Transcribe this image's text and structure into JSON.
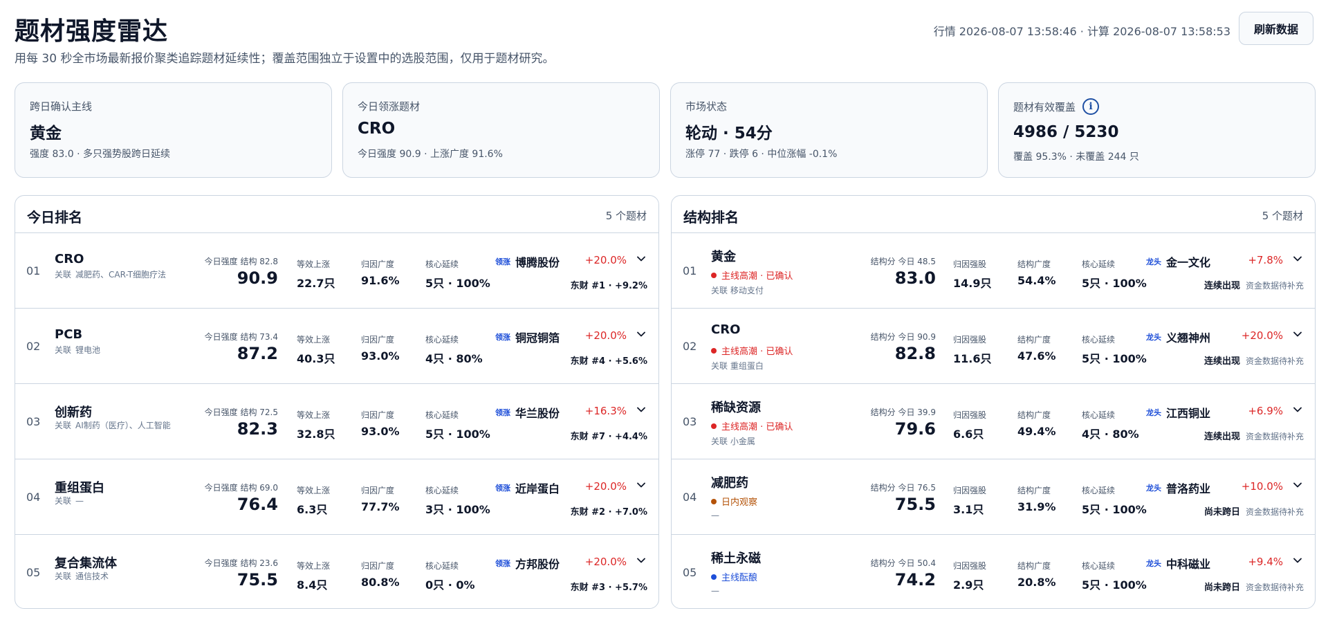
{
  "header": {
    "title": "题材强度雷达",
    "subtitle": "用每 30 秒全市场最新报价聚类追踪题材延续性；覆盖范围独立于设置中的选股范围，仅用于题材研究。",
    "timestamps": "行情 2026-08-07 13:58:46 · 计算 2026-08-07 13:58:53",
    "refresh_label": "刷新数据"
  },
  "cards": [
    {
      "label": "跨日确认主线",
      "value": "黄金",
      "detail": "强度 83.0 · 多只强势股跨日延续"
    },
    {
      "label": "今日领涨题材",
      "value": "CRO",
      "detail": "今日强度 90.9 · 上涨广度 91.6%"
    },
    {
      "label": "市场状态",
      "value": "轮动 · 54分",
      "detail": "涨停 77 · 跌停 6 · 中位涨幅 -0.1%"
    },
    {
      "label": "题材有效覆盖",
      "value": "4986 / 5230",
      "detail": "覆盖 95.3% · 未覆盖 244 只",
      "icon": "info-icon"
    }
  ],
  "colors": {
    "up": "#dc2626",
    "confirmed": "#dc2626",
    "observe": "#b45309",
    "brewing": "#1d4ed8",
    "leader_tag": "#1d4ed8"
  },
  "today": {
    "title": "今日排名",
    "count": "5 个题材",
    "metric_labels": [
      "等效上涨",
      "归因广度",
      "核心延续"
    ],
    "score_label": "今日强度",
    "related_label": "关联",
    "leader_tag": "领涨",
    "rows": [
      {
        "rank": "01",
        "name": "CRO",
        "related": "减肥药、CAR-T细胞疗法",
        "sub_score": "结构 82.8",
        "score": "90.9",
        "m1": "22.7只",
        "m2": "91.6%",
        "m3": "5只 · 100%",
        "leader": "博腾股份",
        "chg": "+20.0%",
        "sub": "东财 #1 · +9.2%"
      },
      {
        "rank": "02",
        "name": "PCB",
        "related": "锂电池",
        "sub_score": "结构 73.4",
        "score": "87.2",
        "m1": "40.3只",
        "m2": "93.0%",
        "m3": "4只 · 80%",
        "leader": "铜冠铜箔",
        "chg": "+20.0%",
        "sub": "东财 #4 · +5.6%"
      },
      {
        "rank": "03",
        "name": "创新药",
        "related": "AI制药（医疗）、人工智能",
        "sub_score": "结构 72.5",
        "score": "82.3",
        "m1": "32.8只",
        "m2": "93.0%",
        "m3": "5只 · 100%",
        "leader": "华兰股份",
        "chg": "+16.3%",
        "sub": "东财 #7 · +4.4%"
      },
      {
        "rank": "04",
        "name": "重组蛋白",
        "related": "—",
        "sub_score": "结构 69.0",
        "score": "76.4",
        "m1": "6.3只",
        "m2": "77.7%",
        "m3": "3只 · 100%",
        "leader": "近岸蛋白",
        "chg": "+20.0%",
        "sub": "东财 #2 · +7.0%"
      },
      {
        "rank": "05",
        "name": "复合集流体",
        "related": "通信技术",
        "sub_score": "结构 23.6",
        "score": "75.5",
        "m1": "8.4只",
        "m2": "80.8%",
        "m3": "0只 · 0%",
        "leader": "方邦股份",
        "chg": "+20.0%",
        "sub": "东财 #3 · +5.7%"
      }
    ]
  },
  "structure": {
    "title": "结构排名",
    "count": "5 个题材",
    "metric_labels": [
      "归因强股",
      "结构广度",
      "核心延续"
    ],
    "score_label": "结构分",
    "related_label": "关联",
    "leader_tag": "龙头",
    "rows": [
      {
        "rank": "01",
        "name": "黄金",
        "status": "主线高潮 · 已确认",
        "status_color": "confirmed",
        "related": "关联 移动支付",
        "sub_score": "今日 48.5",
        "score": "83.0",
        "m1": "14.9只",
        "m2": "54.4%",
        "m3": "5只 · 100%",
        "leader": "金一文化",
        "chg": "+7.8%",
        "sub_strong": "连续出现",
        "sub_muted": "资金数据待补充"
      },
      {
        "rank": "02",
        "name": "CRO",
        "status": "主线高潮 · 已确认",
        "status_color": "confirmed",
        "related": "关联 重组蛋白",
        "sub_score": "今日 90.9",
        "score": "82.8",
        "m1": "11.6只",
        "m2": "47.6%",
        "m3": "5只 · 100%",
        "leader": "义翘神州",
        "chg": "+20.0%",
        "sub_strong": "连续出现",
        "sub_muted": "资金数据待补充"
      },
      {
        "rank": "03",
        "name": "稀缺资源",
        "status": "主线高潮 · 已确认",
        "status_color": "confirmed",
        "related": "关联 小金属",
        "sub_score": "今日 39.9",
        "score": "79.6",
        "m1": "6.6只",
        "m2": "49.4%",
        "m3": "4只 · 80%",
        "leader": "江西铜业",
        "chg": "+6.9%",
        "sub_strong": "连续出现",
        "sub_muted": "资金数据待补充"
      },
      {
        "rank": "04",
        "name": "减肥药",
        "status": "日内观察",
        "status_color": "observe",
        "related": "—",
        "sub_score": "今日 76.5",
        "score": "75.5",
        "m1": "3.1只",
        "m2": "31.9%",
        "m3": "5只 · 100%",
        "leader": "普洛药业",
        "chg": "+10.0%",
        "sub_strong": "尚未跨日",
        "sub_muted": "资金数据待补充"
      },
      {
        "rank": "05",
        "name": "稀土永磁",
        "status": "主线酝酿",
        "status_color": "brewing",
        "related": "—",
        "sub_score": "今日 50.4",
        "score": "74.2",
        "m1": "2.9只",
        "m2": "20.8%",
        "m3": "5只 · 100%",
        "leader": "中科磁业",
        "chg": "+9.4%",
        "sub_strong": "尚未跨日",
        "sub_muted": "资金数据待补充"
      }
    ]
  }
}
